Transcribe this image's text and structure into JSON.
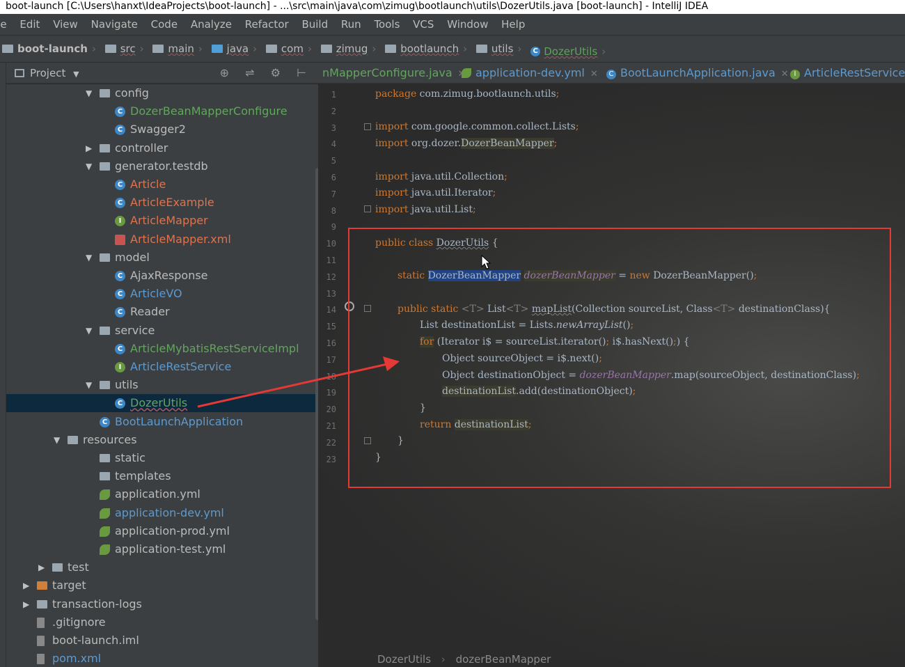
{
  "window": {
    "title": "boot-launch [C:\\Users\\hanxt\\IdeaProjects\\boot-launch] - ...\\src\\main\\java\\com\\zimug\\bootlaunch\\utils\\DozerUtils.java [boot-launch] - IntelliJ IDEA"
  },
  "menu": [
    "ile",
    "Edit",
    "View",
    "Navigate",
    "Code",
    "Analyze",
    "Refactor",
    "Build",
    "Run",
    "Tools",
    "VCS",
    "Window",
    "Help"
  ],
  "breadcrumb": [
    "boot-launch",
    "src",
    "main",
    "java",
    "com",
    "zimug",
    "bootlaunch",
    "utils",
    "DozerUtils"
  ],
  "project_panel": {
    "title": "Project",
    "tools": "⊕ ⇌ ⚙ ⊢"
  },
  "tree": [
    {
      "label": "config",
      "kind": "folder",
      "expanded": true,
      "color": "normal"
    },
    {
      "label": "DozerBeanMapperConfigure",
      "kind": "class",
      "color": "green"
    },
    {
      "label": "Swagger2",
      "kind": "class",
      "color": "normal"
    },
    {
      "label": "controller",
      "kind": "folder",
      "expanded": false,
      "color": "normal"
    },
    {
      "label": "generator.testdb",
      "kind": "folder",
      "expanded": true,
      "color": "normal"
    },
    {
      "label": "Article",
      "kind": "class",
      "color": "red"
    },
    {
      "label": "ArticleExample",
      "kind": "class",
      "color": "red"
    },
    {
      "label": "ArticleMapper",
      "kind": "interface",
      "color": "red"
    },
    {
      "label": "ArticleMapper.xml",
      "kind": "xml",
      "color": "red"
    },
    {
      "label": "model",
      "kind": "folder",
      "expanded": true,
      "color": "normal"
    },
    {
      "label": "AjaxResponse",
      "kind": "class",
      "color": "normal"
    },
    {
      "label": "ArticleVO",
      "kind": "class",
      "color": "blue"
    },
    {
      "label": "Reader",
      "kind": "class",
      "color": "normal"
    },
    {
      "label": "service",
      "kind": "folder",
      "expanded": true,
      "color": "normal"
    },
    {
      "label": "ArticleMybatisRestServiceImpl",
      "kind": "class",
      "color": "green"
    },
    {
      "label": "ArticleRestService",
      "kind": "interface",
      "color": "blue"
    },
    {
      "label": "utils",
      "kind": "folder",
      "expanded": true,
      "color": "normal"
    },
    {
      "label": "DozerUtils",
      "kind": "class",
      "color": "green"
    },
    {
      "label": "BootLaunchApplication",
      "kind": "class",
      "color": "blue"
    },
    {
      "label": "resources",
      "kind": "folder",
      "expanded": true,
      "color": "normal"
    },
    {
      "label": "static",
      "kind": "folder",
      "color": "normal"
    },
    {
      "label": "templates",
      "kind": "folder",
      "color": "normal"
    },
    {
      "label": "application.yml",
      "kind": "yml",
      "color": "normal"
    },
    {
      "label": "application-dev.yml",
      "kind": "yml",
      "color": "blue"
    },
    {
      "label": "application-prod.yml",
      "kind": "yml",
      "color": "normal"
    },
    {
      "label": "application-test.yml",
      "kind": "yml",
      "color": "normal"
    },
    {
      "label": "test",
      "kind": "folder",
      "expanded": false,
      "color": "normal"
    },
    {
      "label": "target",
      "kind": "folder",
      "expanded": false,
      "color": "normal"
    },
    {
      "label": "transaction-logs",
      "kind": "folder",
      "expanded": false,
      "color": "normal"
    },
    {
      "label": ".gitignore",
      "kind": "file",
      "color": "normal"
    },
    {
      "label": "boot-launch.iml",
      "kind": "file",
      "color": "normal"
    },
    {
      "label": "pom.xml",
      "kind": "file",
      "color": "blue"
    }
  ],
  "tabs": [
    {
      "label": "nMapperConfigure.java",
      "color": "green"
    },
    {
      "label": "application-dev.yml",
      "color": "blue"
    },
    {
      "label": "BootLaunchApplication.java",
      "color": "blue"
    },
    {
      "label": "ArticleRestService.j",
      "color": "blue"
    }
  ],
  "code": {
    "line_numbers": [
      "1",
      "2",
      "3",
      "4",
      "5",
      "6",
      "7",
      "8",
      "9",
      "10",
      "11",
      "12",
      "13",
      "14",
      "15",
      "16",
      "17",
      "18",
      "19",
      "20",
      "21",
      "22",
      "23"
    ],
    "l1": [
      "package",
      " com.zimug.bootlaunch.utils",
      ";"
    ],
    "l3": [
      "import",
      " com.google.common.collect.Lists",
      ";"
    ],
    "l4": [
      "import",
      " org.dozer.",
      "DozerBeanMapper",
      ";"
    ],
    "l6": [
      "import",
      " java.util.Collection",
      ";"
    ],
    "l7": [
      "import",
      " java.util.Iterator",
      ";"
    ],
    "l8": [
      "import",
      " java.util.List",
      ";"
    ],
    "l10": [
      "public class ",
      "DozerUtils",
      " {"
    ],
    "l12": [
      "static ",
      "DozerBeanMapper",
      " ",
      "dozerBeanMapper",
      " = ",
      "new ",
      "DozerBeanMapper()",
      ";"
    ],
    "l14": [
      "public static ",
      "<T>",
      " List",
      "<T>",
      " ",
      "mapList",
      "(Collection sourceList, Class",
      "<T>",
      " destinationClass){"
    ],
    "l15": [
      "List destinationList = Lists.",
      "newArrayList",
      "()",
      ";"
    ],
    "l16": [
      "for",
      " (Iterator i$ = sourceList.iterator()",
      ";",
      " i$.hasNext()",
      ";",
      ") {"
    ],
    "l17": [
      "Object sourceObject = i$.next()",
      ";"
    ],
    "l18": [
      "Object destinationObject = ",
      "dozerBeanMapper",
      ".map(sourceObject, destinationClass)",
      ";"
    ],
    "l19": [
      "destinationList",
      ".add(destinationObject)",
      ";"
    ],
    "l20": [
      "}"
    ],
    "l21": [
      "return ",
      "destinationList",
      ";"
    ],
    "l22": [
      "}"
    ],
    "l23": [
      "}"
    ]
  },
  "editor_breadcrumb": [
    "DozerUtils",
    "dozerBeanMapper"
  ]
}
